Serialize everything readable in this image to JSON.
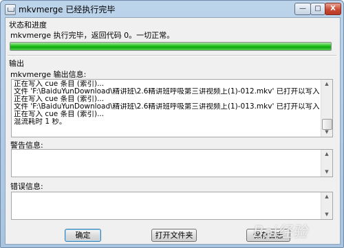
{
  "window": {
    "title": "mkvmerge 已经执行完毕",
    "min_glyph": "—",
    "max_glyph": "□",
    "close_glyph": "X"
  },
  "status": {
    "group_label": "状态和进度",
    "message": "mkvmerge 执行完毕，返回代码 0。一切正常。",
    "progress_fraction": 1.0
  },
  "output": {
    "group_label": "输出",
    "info_label": "mkvmerge 输出信息:",
    "lines": [
      "正在写入 cue 条目 (索引)...",
      "文件 'F:\\BaiduYunDownload\\精讲班\\2.6精讲班呼吸第三讲视频上(1)-012.mkv' 已打开以写入。",
      "正在写入 cue 条目 (索引)...",
      "文件 'F:\\BaiduYunDownload\\精讲班\\2.6精讲班呼吸第三讲视频上(1)-013.mkv' 已打开以写入。",
      "正在写入 cue 条目 (索引)...",
      "混流耗时 1 秒。"
    ],
    "warnings_label": "警告信息:",
    "errors_label": "错误信息:"
  },
  "buttons": {
    "ok": "确定",
    "open_folder": "打开文件夹",
    "save_log": "保存日志"
  },
  "watermark": "Bai经验"
}
